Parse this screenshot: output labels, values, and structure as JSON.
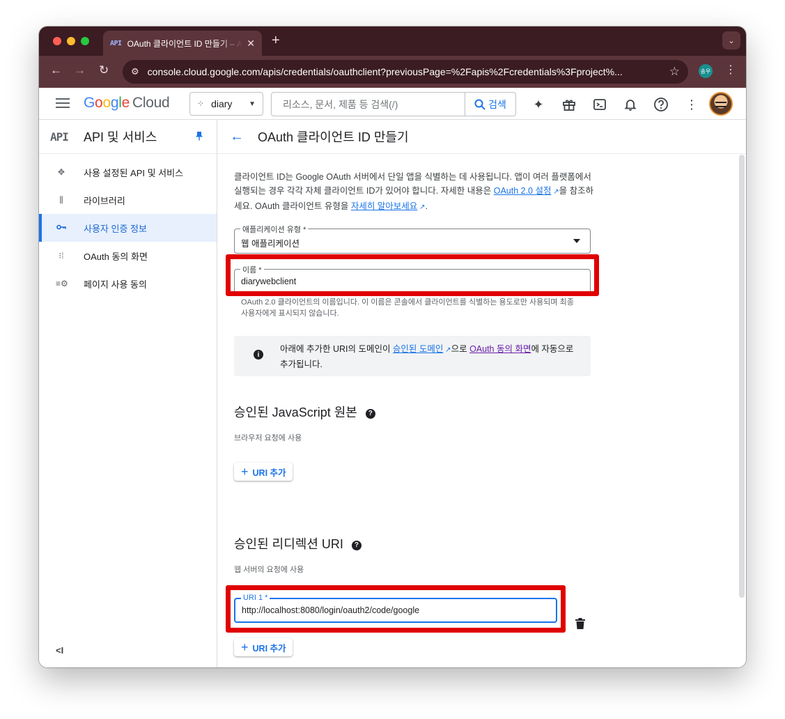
{
  "browser": {
    "tab_title": "OAuth 클라이언트 ID 만들기 – API",
    "tab_favicon": "API",
    "tab_close": "✕",
    "new_tab": "+",
    "url": "console.cloud.google.com/apis/credentials/oauthclient?previousPage=%2Fapis%2Fcredentials%3Fproject%...",
    "profile_badge": "송우"
  },
  "header": {
    "logo_letters": [
      "G",
      "o",
      "o",
      "g",
      "l",
      "e"
    ],
    "logo_cloud": "Cloud",
    "project_name": "diary",
    "search_placeholder": "리소스, 문서, 제품 등 검색(/)",
    "search_button": "검색"
  },
  "sidebar": {
    "api_glyph": "API",
    "title": "API 및 서비스",
    "items": [
      {
        "label": "사용 설정된 API 및 서비스",
        "icon": "api-hub-icon",
        "active": false
      },
      {
        "label": "라이브러리",
        "icon": "library-icon",
        "active": false
      },
      {
        "label": "사용자 인증 정보",
        "icon": "key-icon",
        "active": true
      },
      {
        "label": "OAuth 동의 화면",
        "icon": "consent-icon",
        "active": false
      },
      {
        "label": "페이지 사용 동의",
        "icon": "settings-list-icon",
        "active": false
      }
    ],
    "collapse_label": "<I"
  },
  "page": {
    "title": "OAuth 클라이언트 ID 만들기",
    "desc_1": "클라이언트 ID는 Google OAuth 서버에서 단일 앱을 식별하는 데 사용됩니다. 앱이 여러 플랫폼에서 실행되는 경우 각각 자체 클라이언트 ID가 있어야 합니다. 자세한 내용은 ",
    "desc_link_1": "OAuth 2.0 설정",
    "desc_2": "을 참조하세요. OAuth 클라이언트 유형을 ",
    "desc_link_2": "자세히 알아보세요",
    "desc_3": ".",
    "app_type_label": "애플리케이션 유형 *",
    "app_type_value": "웹 애플리케이션",
    "name_label": "이름 *",
    "name_value": "diarywebclient",
    "name_hint": "OAuth 2.0 클라이언트의 이름입니다. 이 이름은 콘솔에서 클라이언트를 식별하는 용도로만 사용되며 최종 사용자에게 표시되지 않습니다.",
    "notice_1": "아래에 추가한 URI의 도메인이 ",
    "notice_link_1": "승인된 도메인",
    "notice_2": "으로 ",
    "notice_link_2": "OAuth 동의 화면",
    "notice_3": "에 자동으로 추가됩니다.",
    "js_origins_title": "승인된 JavaScript 원본",
    "js_origins_sub": "브라우저 요청에 사용",
    "add_uri_label": "URI 추가",
    "redirect_title": "승인된 리디렉션 URI",
    "redirect_sub": "웹 서버의 요청에 사용",
    "uri1_label": "URI 1 *",
    "uri1_value": "http://localhost:8080/login/oauth2/code/google"
  },
  "colors": {
    "accent": "#1a73e8",
    "highlight": "#e00000",
    "titlebar": "#3a1c22",
    "addressbar": "#5c353b"
  }
}
